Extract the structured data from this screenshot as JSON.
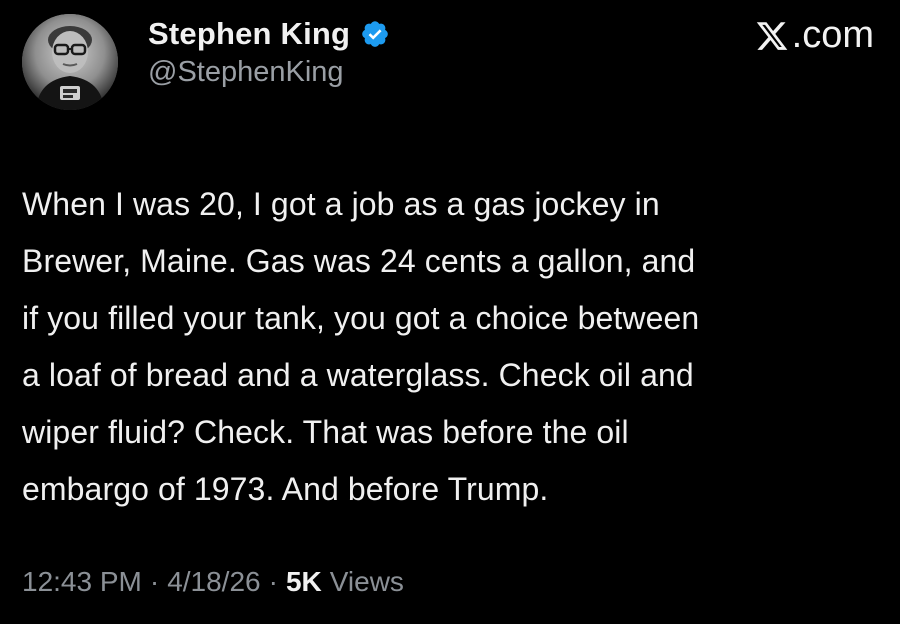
{
  "author": {
    "display_name": "Stephen King",
    "handle": "@StephenKing",
    "verified": true,
    "verified_color": "#1d9bf0"
  },
  "brand": {
    "label": ".com",
    "logo_icon": "x-logo-icon"
  },
  "tweet": {
    "text": "When I was 20, I got a job as a gas jockey in\nBrewer, Maine. Gas was 24 cents a gallon, and\nif you filled your tank, you got a choice between\na loaf of bread and a waterglass. Check oil and\nwiper fluid? Check. That was before the oil\nembargo of 1973. And before Trump."
  },
  "meta": {
    "time": "12:43 PM",
    "date": "4/18/26",
    "separator": "·",
    "views_count": "5K",
    "views_label": "Views"
  },
  "colors": {
    "background": "#000000",
    "primary_text": "#e7e9ea",
    "secondary_text": "#8b9096"
  }
}
